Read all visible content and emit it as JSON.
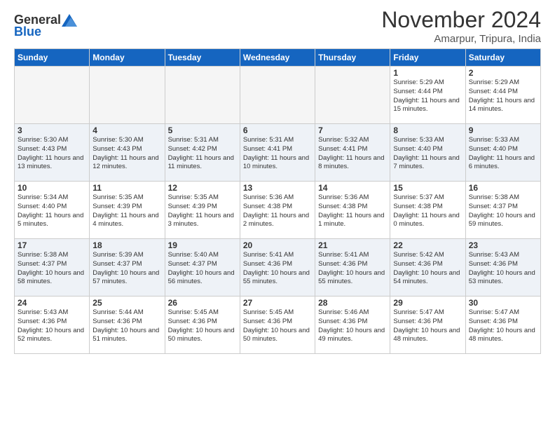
{
  "header": {
    "logo_general": "General",
    "logo_blue": "Blue",
    "title": "November 2024",
    "location": "Amarpur, Tripura, India"
  },
  "calendar": {
    "days": [
      "Sunday",
      "Monday",
      "Tuesday",
      "Wednesday",
      "Thursday",
      "Friday",
      "Saturday"
    ],
    "rows": [
      {
        "alt": false,
        "cells": [
          {
            "empty": true
          },
          {
            "empty": true
          },
          {
            "empty": true
          },
          {
            "empty": true
          },
          {
            "empty": true
          },
          {
            "day": 1,
            "info": "Sunrise: 5:29 AM\nSunset: 4:44 PM\nDaylight: 11 hours and 15 minutes."
          },
          {
            "day": 2,
            "info": "Sunrise: 5:29 AM\nSunset: 4:44 PM\nDaylight: 11 hours and 14 minutes."
          }
        ]
      },
      {
        "alt": true,
        "cells": [
          {
            "day": 3,
            "info": "Sunrise: 5:30 AM\nSunset: 4:43 PM\nDaylight: 11 hours and 13 minutes."
          },
          {
            "day": 4,
            "info": "Sunrise: 5:30 AM\nSunset: 4:43 PM\nDaylight: 11 hours and 12 minutes."
          },
          {
            "day": 5,
            "info": "Sunrise: 5:31 AM\nSunset: 4:42 PM\nDaylight: 11 hours and 11 minutes."
          },
          {
            "day": 6,
            "info": "Sunrise: 5:31 AM\nSunset: 4:41 PM\nDaylight: 11 hours and 10 minutes."
          },
          {
            "day": 7,
            "info": "Sunrise: 5:32 AM\nSunset: 4:41 PM\nDaylight: 11 hours and 8 minutes."
          },
          {
            "day": 8,
            "info": "Sunrise: 5:33 AM\nSunset: 4:40 PM\nDaylight: 11 hours and 7 minutes."
          },
          {
            "day": 9,
            "info": "Sunrise: 5:33 AM\nSunset: 4:40 PM\nDaylight: 11 hours and 6 minutes."
          }
        ]
      },
      {
        "alt": false,
        "cells": [
          {
            "day": 10,
            "info": "Sunrise: 5:34 AM\nSunset: 4:40 PM\nDaylight: 11 hours and 5 minutes."
          },
          {
            "day": 11,
            "info": "Sunrise: 5:35 AM\nSunset: 4:39 PM\nDaylight: 11 hours and 4 minutes."
          },
          {
            "day": 12,
            "info": "Sunrise: 5:35 AM\nSunset: 4:39 PM\nDaylight: 11 hours and 3 minutes."
          },
          {
            "day": 13,
            "info": "Sunrise: 5:36 AM\nSunset: 4:38 PM\nDaylight: 11 hours and 2 minutes."
          },
          {
            "day": 14,
            "info": "Sunrise: 5:36 AM\nSunset: 4:38 PM\nDaylight: 11 hours and 1 minute."
          },
          {
            "day": 15,
            "info": "Sunrise: 5:37 AM\nSunset: 4:38 PM\nDaylight: 11 hours and 0 minutes."
          },
          {
            "day": 16,
            "info": "Sunrise: 5:38 AM\nSunset: 4:37 PM\nDaylight: 10 hours and 59 minutes."
          }
        ]
      },
      {
        "alt": true,
        "cells": [
          {
            "day": 17,
            "info": "Sunrise: 5:38 AM\nSunset: 4:37 PM\nDaylight: 10 hours and 58 minutes."
          },
          {
            "day": 18,
            "info": "Sunrise: 5:39 AM\nSunset: 4:37 PM\nDaylight: 10 hours and 57 minutes."
          },
          {
            "day": 19,
            "info": "Sunrise: 5:40 AM\nSunset: 4:37 PM\nDaylight: 10 hours and 56 minutes."
          },
          {
            "day": 20,
            "info": "Sunrise: 5:41 AM\nSunset: 4:36 PM\nDaylight: 10 hours and 55 minutes."
          },
          {
            "day": 21,
            "info": "Sunrise: 5:41 AM\nSunset: 4:36 PM\nDaylight: 10 hours and 55 minutes."
          },
          {
            "day": 22,
            "info": "Sunrise: 5:42 AM\nSunset: 4:36 PM\nDaylight: 10 hours and 54 minutes."
          },
          {
            "day": 23,
            "info": "Sunrise: 5:43 AM\nSunset: 4:36 PM\nDaylight: 10 hours and 53 minutes."
          }
        ]
      },
      {
        "alt": false,
        "cells": [
          {
            "day": 24,
            "info": "Sunrise: 5:43 AM\nSunset: 4:36 PM\nDaylight: 10 hours and 52 minutes."
          },
          {
            "day": 25,
            "info": "Sunrise: 5:44 AM\nSunset: 4:36 PM\nDaylight: 10 hours and 51 minutes."
          },
          {
            "day": 26,
            "info": "Sunrise: 5:45 AM\nSunset: 4:36 PM\nDaylight: 10 hours and 50 minutes."
          },
          {
            "day": 27,
            "info": "Sunrise: 5:45 AM\nSunset: 4:36 PM\nDaylight: 10 hours and 50 minutes."
          },
          {
            "day": 28,
            "info": "Sunrise: 5:46 AM\nSunset: 4:36 PM\nDaylight: 10 hours and 49 minutes."
          },
          {
            "day": 29,
            "info": "Sunrise: 5:47 AM\nSunset: 4:36 PM\nDaylight: 10 hours and 48 minutes."
          },
          {
            "day": 30,
            "info": "Sunrise: 5:47 AM\nSunset: 4:36 PM\nDaylight: 10 hours and 48 minutes."
          }
        ]
      }
    ]
  }
}
